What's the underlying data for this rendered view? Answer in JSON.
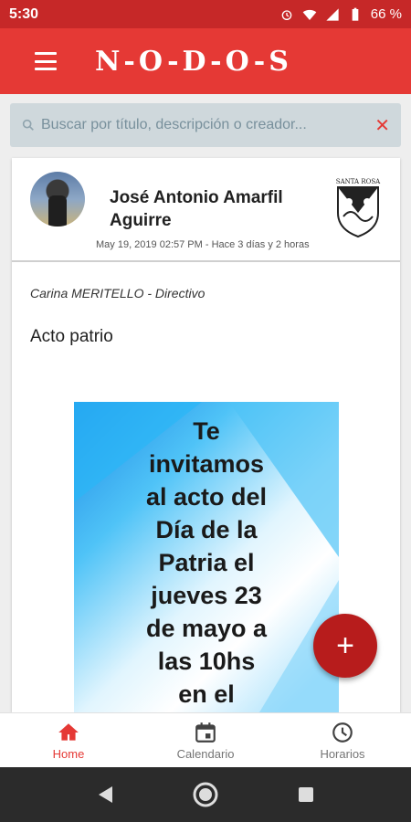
{
  "status_bar": {
    "time": "5:30",
    "battery": "66 %"
  },
  "app_bar": {
    "logo_text": "N-O-D-O-S"
  },
  "search": {
    "placeholder": "Buscar por título, descripción o creador...",
    "clear": "✕"
  },
  "post": {
    "author_name": "José Antonio Amarfil Aguirre",
    "date": "May 19, 2019 02:57 PM - Hace 3 días y 2 horas",
    "role": "Carina MERITELLO - Directivo",
    "title": "Acto patrio",
    "image_text": "Te\ninvitamos\nal acto del\nDía de la\nPatria el\njueves 23\nde mayo a\nlas 10hs\nen el",
    "school_logo_text": "SANTA ROSA"
  },
  "fab": {
    "label": "+"
  },
  "bottom_nav": [
    {
      "label": "Home",
      "icon": "home-icon",
      "active": true
    },
    {
      "label": "Calendario",
      "icon": "calendar-icon",
      "active": false
    },
    {
      "label": "Horarios",
      "icon": "clock-icon",
      "active": false
    }
  ],
  "colors": {
    "primary": "#e53935",
    "status": "#c62828",
    "fab": "#b71c1c"
  }
}
